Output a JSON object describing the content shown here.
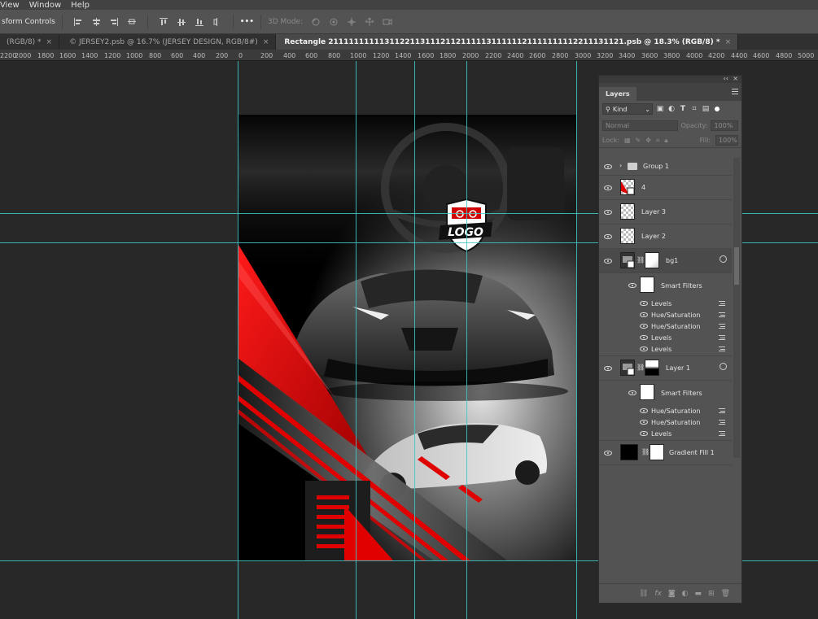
{
  "menu": [
    "View",
    "Window",
    "Help"
  ],
  "options_bar": {
    "transform_label": "sform Controls",
    "more": "•••",
    "mode_3d_label": "3D Mode:"
  },
  "tabs": [
    {
      "label": "(RGB/8) *",
      "close": "×"
    },
    {
      "label": "© JERSEY2.psb @ 16.7% (JERSEY DESIGN, RGB/8#)",
      "close": "×"
    },
    {
      "label": "Rectangle 2111111111131122113111211211111311111121111111112211131121.psb @ 18.3% (RGB/8) *",
      "close": "×"
    }
  ],
  "ruler": [
    "2200",
    "2000",
    "1800",
    "1600",
    "1400",
    "1200",
    "1000",
    "800",
    "600",
    "400",
    "200",
    "0",
    "200",
    "400",
    "600",
    "800",
    "1000",
    "1200",
    "1400",
    "1600",
    "1800",
    "2000",
    "2200",
    "2400",
    "2600",
    "2800",
    "3000",
    "3200",
    "3400",
    "3600",
    "3800",
    "4000",
    "4200",
    "4400",
    "4600",
    "4800",
    "5000"
  ],
  "artwork": {
    "logo_text": "LOGO"
  },
  "layers_panel": {
    "title": "Layers",
    "filter_kind": "Kind",
    "blend_mode": "Normal",
    "opacity_label": "Opacity:",
    "opacity_value": "100%",
    "lock_label": "Lock:",
    "fill_label": "Fill:",
    "fill_value": "100%",
    "layers": [
      {
        "name": "Group 1",
        "type": "group"
      },
      {
        "name": "4",
        "type": "layer"
      },
      {
        "name": "Layer 3",
        "type": "layer"
      },
      {
        "name": "Layer 2",
        "type": "layer"
      },
      {
        "name": "bg1",
        "type": "smart",
        "smart_filters_label": "Smart Filters",
        "filters": [
          "Levels",
          "Hue/Saturation",
          "Hue/Saturation",
          "Levels",
          "Levels"
        ]
      },
      {
        "name": "Layer 1",
        "type": "smart",
        "smart_filters_label": "Smart Filters",
        "filters": [
          "Hue/Saturation",
          "Hue/Saturation",
          "Levels"
        ]
      },
      {
        "name": "Gradient Fill 1",
        "type": "fill"
      }
    ],
    "bottom_icons": [
      "link-icon",
      "fx-icon",
      "mask-icon",
      "adjustment-icon",
      "folder-icon",
      "new-layer-icon",
      "trash-icon"
    ]
  },
  "colors": {
    "guide": "#3fc9c9",
    "accent_red": "#e00000",
    "panel": "#535353",
    "canvas_bg": "#282828"
  }
}
